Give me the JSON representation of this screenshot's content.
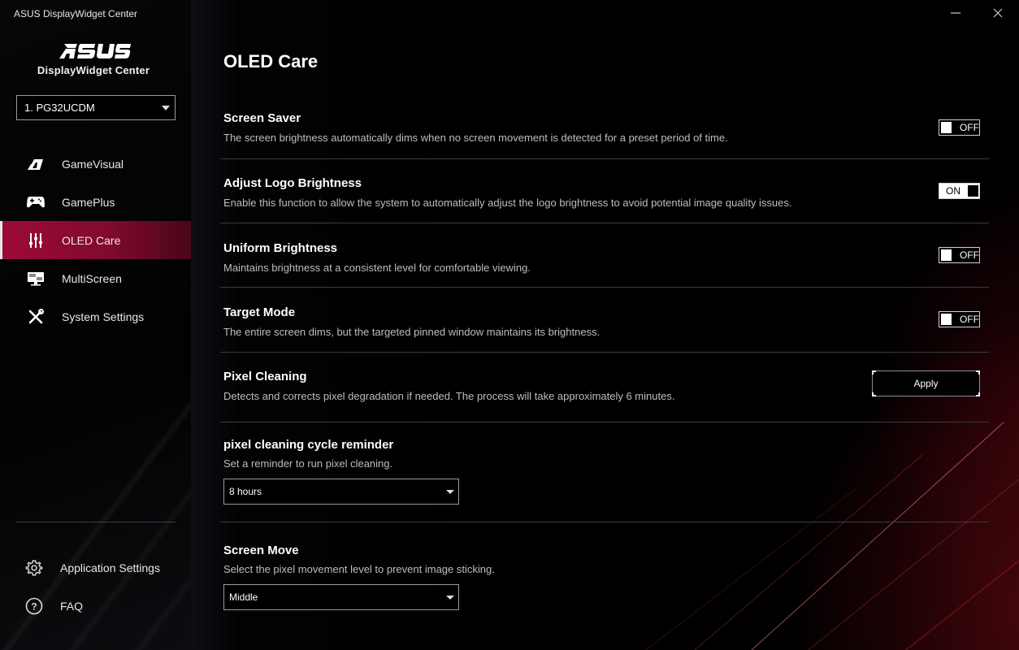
{
  "window": {
    "title": "ASUS DisplayWidget Center",
    "minimize_icon": "minimize-icon",
    "close_icon": "close-icon"
  },
  "sidebar": {
    "logo_text": "ASUS",
    "logo_subtitle": "DisplayWidget Center",
    "monitor_select": {
      "value": "1. PG32UCDM"
    },
    "items": [
      {
        "label": "GameVisual",
        "icon": "gamevisual-icon",
        "active": false
      },
      {
        "label": "GamePlus",
        "icon": "gamepad-icon",
        "active": false
      },
      {
        "label": "OLED Care",
        "icon": "sliders-icon",
        "active": true
      },
      {
        "label": "MultiScreen",
        "icon": "multiscreen-icon",
        "active": false
      },
      {
        "label": "System Settings",
        "icon": "tools-icon",
        "active": false
      }
    ],
    "bottom_items": [
      {
        "label": "Application Settings",
        "icon": "gear-icon"
      },
      {
        "label": "FAQ",
        "icon": "help-icon"
      }
    ]
  },
  "main": {
    "title": "OLED Care",
    "settings": [
      {
        "label": "Screen Saver",
        "description": "The screen brightness automatically dims when no screen movement is detected for a preset period of time.",
        "control": "toggle",
        "state": "OFF"
      },
      {
        "label": "Adjust Logo Brightness",
        "description": "Enable this function to allow the system to automatically adjust the logo brightness to avoid potential image quality issues.",
        "control": "toggle",
        "state": "ON"
      },
      {
        "label": "Uniform Brightness",
        "description": "Maintains brightness at a consistent level for comfortable viewing.",
        "control": "toggle",
        "state": "OFF"
      },
      {
        "label": "Target Mode",
        "description": "The entire screen dims, but the targeted pinned window maintains its brightness.",
        "control": "toggle",
        "state": "OFF"
      },
      {
        "label": "Pixel Cleaning",
        "description": "Detects and corrects pixel degradation if needed. The process will take approximately 6 minutes.",
        "control": "button",
        "button_label": "Apply"
      },
      {
        "label": "pixel cleaning cycle reminder",
        "description": "Set a reminder to run pixel cleaning.",
        "control": "dropdown",
        "value": "8 hours"
      },
      {
        "label": "Screen Move",
        "description": "Select the pixel movement level to prevent image sticking.",
        "control": "dropdown",
        "value": "Middle"
      }
    ]
  },
  "colors": {
    "accent": "#9c0b36",
    "background": "#000000",
    "text_primary": "#ffffff",
    "text_secondary": "#bdbdbd"
  }
}
